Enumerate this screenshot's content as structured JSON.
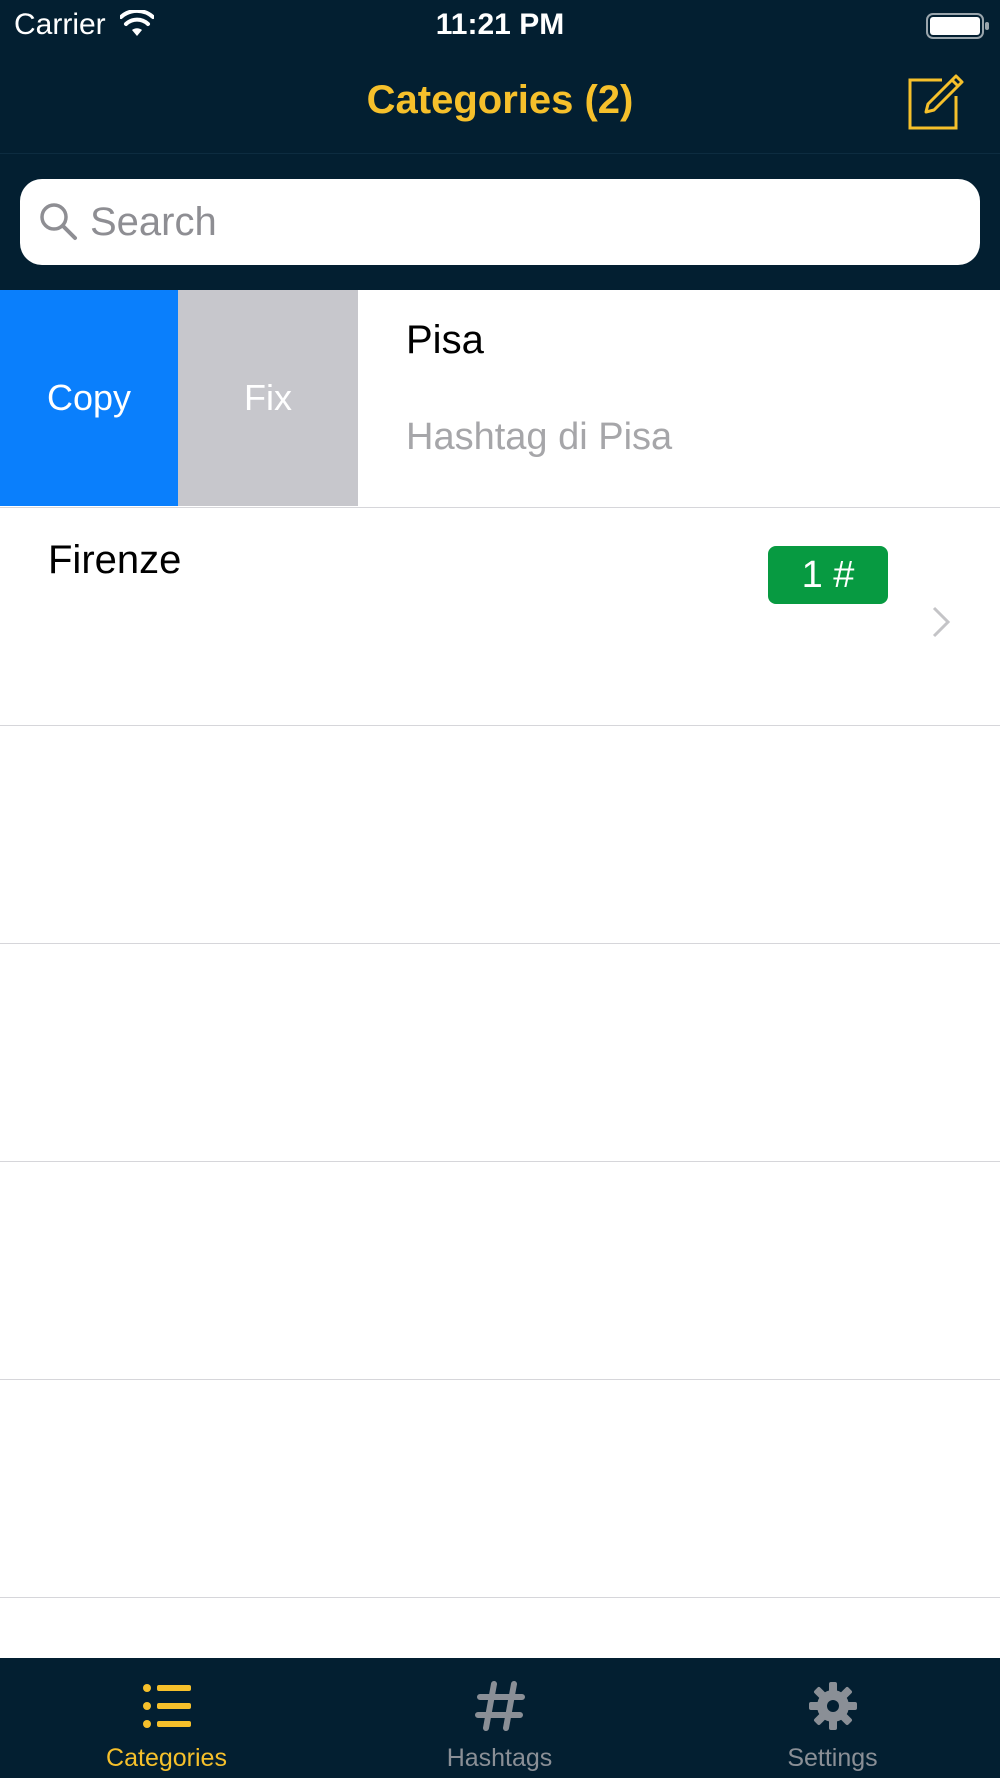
{
  "colors": {
    "nav_background": "#031f31",
    "accent": "#f6c02b",
    "copy_action": "#0a7ffc",
    "fix_action": "#c7c7cc",
    "badge": "#079a41",
    "inactive_tab": "#8a8f96"
  },
  "status_bar": {
    "carrier": "Carrier",
    "time": "11:21 PM",
    "icons": [
      "wifi-icon",
      "battery-icon"
    ]
  },
  "nav": {
    "title": "Categories (2)",
    "right_icon": "compose-icon"
  },
  "search": {
    "placeholder": "Search",
    "value": "",
    "icon": "search-icon"
  },
  "rows": [
    {
      "title": "Pisa",
      "subtitle": "Hashtag di Pisa",
      "swipe_actions": [
        {
          "label": "Copy"
        },
        {
          "label": "Fix"
        }
      ]
    },
    {
      "title": "Firenze",
      "badge": "1 #",
      "accessory_icon": "chevron-right-icon"
    }
  ],
  "tabs": [
    {
      "label": "Categories",
      "icon": "list-icon",
      "selected": true
    },
    {
      "label": "Hashtags",
      "icon": "hashtag-icon",
      "selected": false
    },
    {
      "label": "Settings",
      "icon": "gear-icon",
      "selected": false
    }
  ]
}
